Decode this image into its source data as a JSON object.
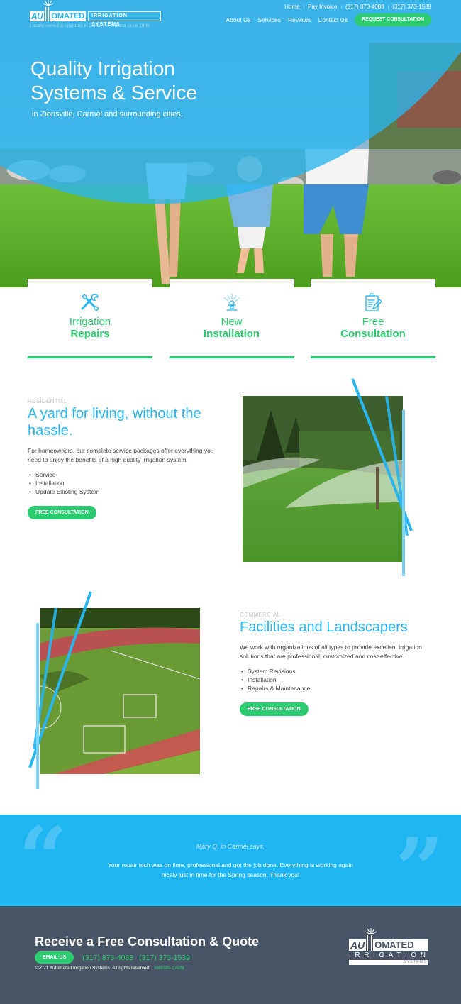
{
  "brand": {
    "logo_part1": "AU",
    "logo_part2": "OMATED",
    "logo_irrigation": "IRRIGATION SYSTEMS",
    "tagline": "Locally owned & operated in Zionsville, Indiana since 1989"
  },
  "top_nav": [
    {
      "label": "Home"
    },
    {
      "label": "Pay Invoice"
    },
    {
      "label": "(317) 873-4088"
    },
    {
      "label": "(317) 373-1539"
    }
  ],
  "main_nav": [
    {
      "label": "About Us"
    },
    {
      "label": "Services"
    },
    {
      "label": "Reviews"
    },
    {
      "label": "Contact Us"
    }
  ],
  "request_button": "REQUEST CONSULTATION",
  "hero": {
    "title_line1": "Quality Irrigation",
    "title_line2": "Systems & Service",
    "subtitle": "in Zionsville, Carmel and surrounding cities."
  },
  "cards": [
    {
      "line1": "Irrigation",
      "line2": "Repairs",
      "icon": "tools-icon"
    },
    {
      "line1": "New",
      "line2": "Installation",
      "icon": "sprinkler-icon"
    },
    {
      "line1": "Free",
      "line2": "Consultation",
      "icon": "clipboard-icon"
    }
  ],
  "residential": {
    "eyebrow": "RESIDENTIAL",
    "title": "A yard for living, without the hassle.",
    "body": "For homeowners, our complete service packages offer everything you need to enjoy the benefits of a high quality irrigation system.",
    "list": [
      "Service",
      "Installation",
      "Update Existing System"
    ],
    "button": "FREE CONSULTATION"
  },
  "commercial": {
    "eyebrow": "COMMERCIAL",
    "title": "Facilities and Landscapers",
    "body": "We work with organizations of all types to provide excellent irrigation solutions that are professional, customized and cost-effective.",
    "list": [
      "System Revisions",
      "Installation",
      "Repairs & Maintenance"
    ],
    "button": "FREE CONSULTATION"
  },
  "testimonial": {
    "open_quote": "“",
    "close_quote": "”",
    "author": "Mary Q. in Carmel says,",
    "quote": "Your repair tech was on time, professional and got the job done. Everything is working again nicely just in time for the Spring season. Thank you!"
  },
  "footer": {
    "title": "Receive a Free Consultation & Quote",
    "email_button": "EMAIL US",
    "phone1": "(317) 873-4088",
    "phone2": "(317) 373-1539",
    "copyright": "©2021 Automated Irrigation Systems. All rights reserved. | ",
    "credit": "Website Credit",
    "logo_part1": "AU",
    "logo_part2": "OMATED",
    "logo_irrigation": "IRRIGATION",
    "logo_systems": "SYSTEMS"
  },
  "colors": {
    "brand_blue": "#29b6f0",
    "brand_green": "#2ecc71",
    "testimonial_bg": "#1fb5f2",
    "footer_bg": "#485566"
  }
}
